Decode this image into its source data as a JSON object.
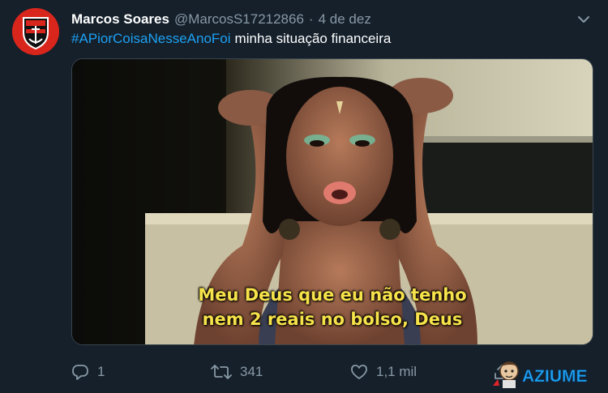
{
  "tweet": {
    "author_name": "Marcos Soares",
    "author_handle": "@MarcosS17212866",
    "separator": "·",
    "date": "4 de dez",
    "hashtag": "#APiorCoisaNesseAnoFoi",
    "text": "minha situação financeira"
  },
  "media": {
    "caption_line1": "Meu Deus que eu não tenho",
    "caption_line2": "nem 2 reais no bolso, Deus"
  },
  "actions": {
    "replies": "1",
    "retweets": "341",
    "likes": "1,1 mil"
  },
  "watermark": {
    "text": "AZIUME"
  },
  "colors": {
    "background": "#15202b",
    "secondary_text": "#8899a6",
    "link": "#1da1f2",
    "caption": "#f6e24a",
    "avatar": "#d9261c"
  },
  "icons": [
    "crest-icon",
    "chevron-down-icon",
    "reply-icon",
    "retweet-icon",
    "like-icon",
    "share-icon",
    "mascot-icon"
  ]
}
